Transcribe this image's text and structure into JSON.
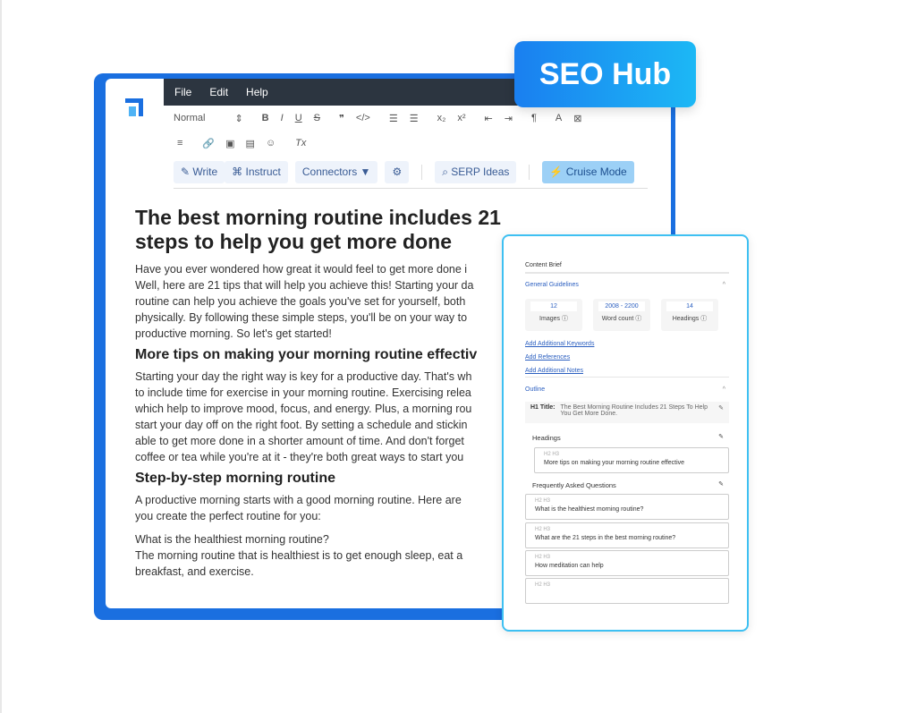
{
  "badge": "SEO Hub",
  "menu": [
    "File",
    "Edit",
    "Help"
  ],
  "toolbar": {
    "style": "Normal",
    "row1": [
      "⇕",
      "B",
      "I",
      "U",
      "S",
      "❞",
      "</>",
      "☰",
      "☰",
      "x₂",
      "x²",
      "⇤",
      "⇥",
      "¶",
      "A",
      "⊠"
    ],
    "row2": [
      "≡",
      "🔗",
      "▣",
      "▤",
      "☺",
      "Tx"
    ]
  },
  "actions": {
    "write": "✎ Write",
    "instruct": "⌘ Instruct",
    "connectors": "Connectors ▼",
    "settings": "⚙",
    "serp": "⌕ SERP Ideas",
    "cruise": "⚡ Cruise Mode"
  },
  "doc": {
    "title": "The best morning routine includes 21 steps to help you get more done",
    "p1": [
      "Have you ever wondered how great it would feel to get more done i",
      "Well, here are 21 tips that will help you achieve this! Starting your da",
      "routine can help you achieve the goals you've set for yourself, both",
      "physically. By following these simple steps, you'll be on your way to",
      "productive morning. So let's get started!"
    ],
    "h2a": "More tips on making your morning routine effectiv",
    "p2": [
      "Starting your day the right way is key for a productive day. That's wh",
      "to include time for exercise in your morning routine. Exercising relea",
      "which help to improve mood, focus, and energy. Plus, a morning rou",
      "start your day off on the right foot. By setting a schedule and stickin",
      "able to get more done in a shorter amount of time. And don't forget",
      "coffee or tea while you're at it - they're both great ways to start you"
    ],
    "h2b": "Step-by-step morning routine",
    "p3": [
      "A productive morning starts with a good morning routine. Here are",
      "you create the perfect routine for you:"
    ],
    "p4": [
      "What is the healthiest morning routine?",
      "The morning routine that is healthiest is to get enough sleep, eat a",
      "breakfast, and exercise."
    ]
  },
  "panel": {
    "title": "Content Brief",
    "guidelines": "General Guidelines",
    "stats": [
      {
        "value": "12",
        "label": "Images ⓘ"
      },
      {
        "value": "2008 - 2200",
        "label": "Word count ⓘ"
      },
      {
        "value": "14",
        "label": "Headings ⓘ"
      }
    ],
    "links": [
      "Add Additional Keywords",
      "Add References",
      "Add Additional Notes"
    ],
    "outline": "Outline",
    "h1_label": "H1 Title:",
    "h1_value": "The Best Morning Routine Includes 21 Steps To Help You Get More Done.",
    "headings_label": "Headings",
    "heading_item": {
      "tag": "H2  H3",
      "text": "More tips on making your morning routine effective"
    },
    "faq_label": "Frequently Asked Questions",
    "faqs": [
      {
        "tag": "H2  H3",
        "text": "What is the healthiest morning routine?"
      },
      {
        "tag": "H2  H3",
        "text": "What are the 21 steps in the best morning routine?"
      },
      {
        "tag": "H2  H3",
        "text": "How meditation can help"
      },
      {
        "tag": "H2  H3",
        "text": ""
      }
    ]
  }
}
